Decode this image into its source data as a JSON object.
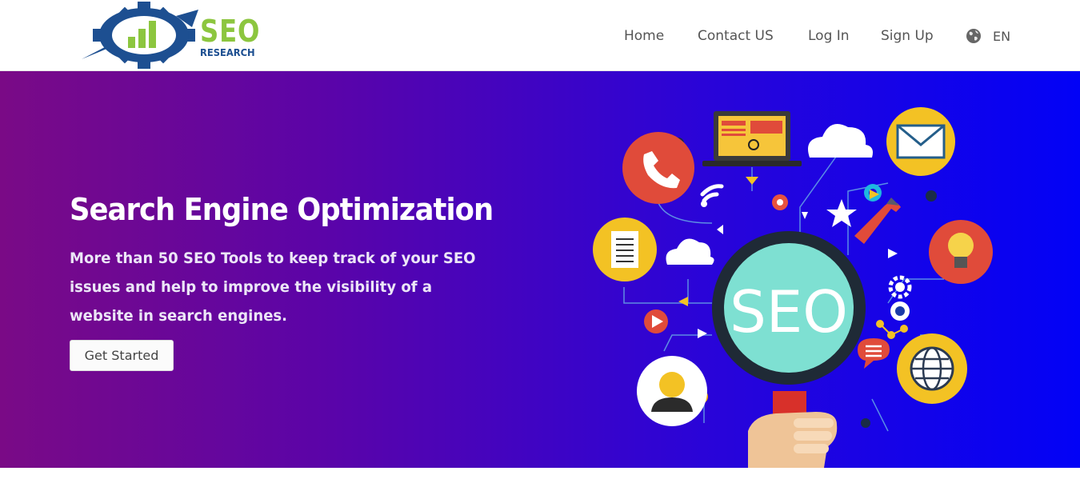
{
  "brand": {
    "logo_main": "SEO",
    "logo_sub": "RESEARCH"
  },
  "nav": {
    "items": [
      {
        "label": "Home"
      },
      {
        "label": "Contact US"
      },
      {
        "label": "Log In"
      },
      {
        "label": "Sign Up"
      }
    ],
    "language": {
      "label": "EN",
      "icon": "globe-icon"
    }
  },
  "hero": {
    "title": "Search Engine Optimization",
    "subtitle": "More than 50 SEO Tools to keep track of your SEO issues and help to improve the visibility of a website in search engines.",
    "cta_label": "Get Started",
    "illustration_text": "SEO"
  },
  "colors": {
    "logo_green": "#8cc63f",
    "logo_blue": "#1d4f91",
    "gradient_start": "#7a0a86",
    "gradient_end": "#0202f6"
  }
}
